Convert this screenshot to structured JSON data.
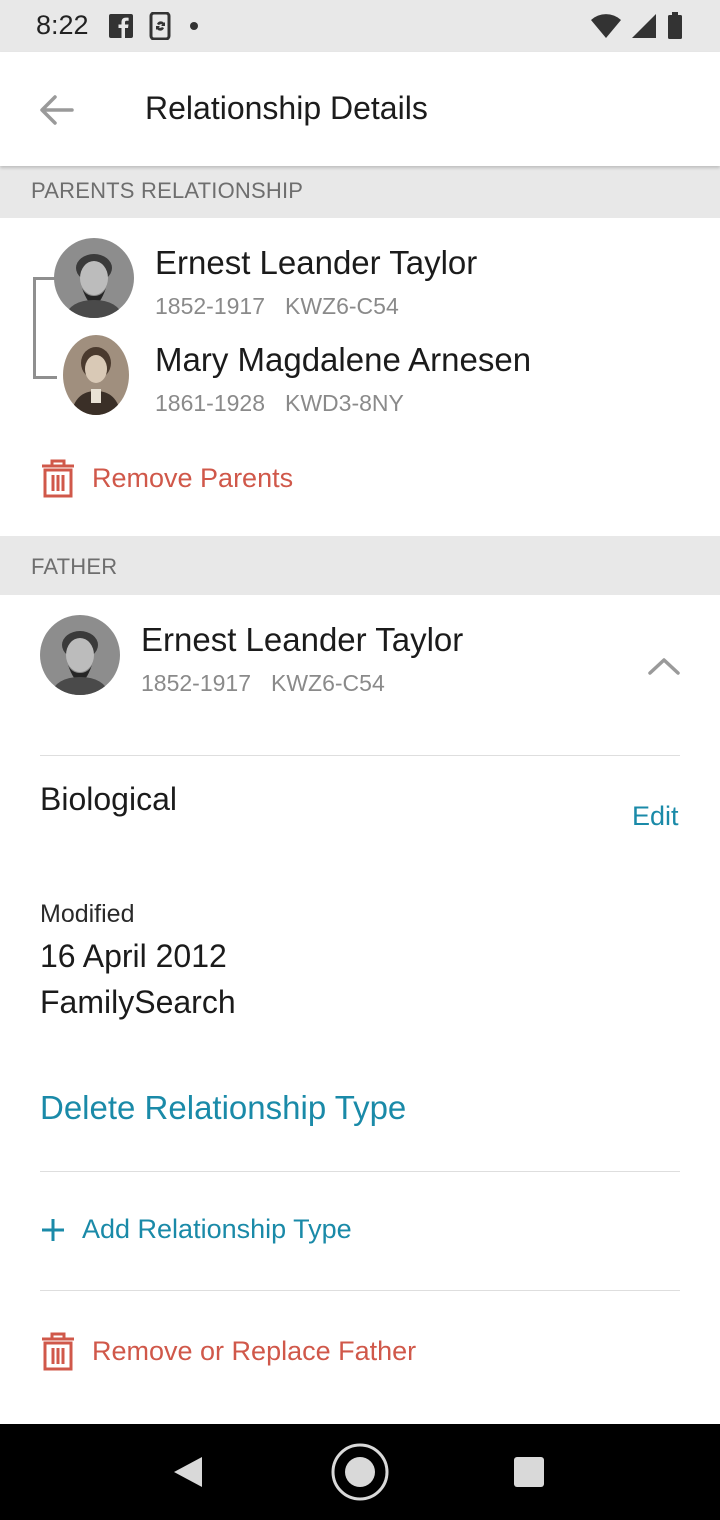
{
  "status_bar": {
    "time": "8:22"
  },
  "app_bar": {
    "title": "Relationship Details"
  },
  "parents_section": {
    "header": "PARENTS RELATIONSHIP",
    "father": {
      "name": "Ernest Leander Taylor",
      "years": "1852-1917",
      "id": "KWZ6-C54"
    },
    "mother": {
      "name": "Mary Magdalene Arnesen",
      "years": "1861-1928",
      "id": "KWD3-8NY"
    },
    "remove_label": "Remove Parents"
  },
  "father_section": {
    "header": "FATHER",
    "person": {
      "name": "Ernest Leander Taylor",
      "years": "1852-1917",
      "id": "KWZ6-C54"
    },
    "relationship_type": "Biological",
    "edit_label": "Edit",
    "modified_label": "Modified",
    "modified_date": "16 April 2012",
    "modified_by": "FamilySearch",
    "delete_label": "Delete Relationship Type",
    "add_label": "Add Relationship Type",
    "remove_label": "Remove or Replace Father"
  },
  "colors": {
    "accent_blue": "#1a8aa8",
    "danger_red": "#d0584a",
    "section_bg": "#e8e8e8"
  }
}
